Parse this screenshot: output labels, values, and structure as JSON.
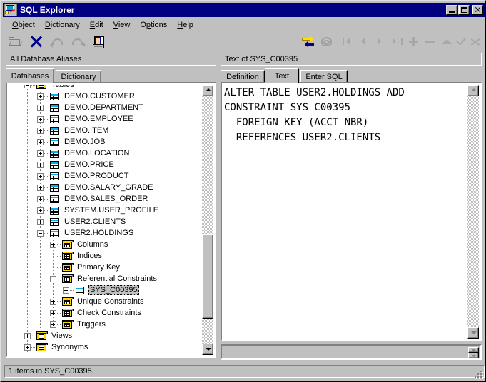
{
  "window": {
    "title": "SQL Explorer",
    "icon": "sql-explorer-icon",
    "minimize_label": "Minimize",
    "maximize_label": "Maximize",
    "close_label": "Close"
  },
  "menu": [
    {
      "label": "Object",
      "accel": "O"
    },
    {
      "label": "Dictionary",
      "accel": "D"
    },
    {
      "label": "Edit",
      "accel": "E"
    },
    {
      "label": "View",
      "accel": "V"
    },
    {
      "label": "Options",
      "accel": "O"
    },
    {
      "label": "Help",
      "accel": "H"
    }
  ],
  "toolbar": {
    "left": [
      {
        "name": "open-icon",
        "enabled": false
      },
      {
        "name": "delete-x-icon",
        "enabled": true
      },
      {
        "name": "undo-icon",
        "enabled": false
      },
      {
        "name": "redo-icon",
        "enabled": false
      },
      {
        "name": "report-icon",
        "enabled": true
      }
    ],
    "right": [
      {
        "name": "swap-arrows-icon",
        "enabled": true
      },
      {
        "name": "refresh-swirl-icon",
        "enabled": false
      },
      {
        "name": "first-record-icon",
        "enabled": false
      },
      {
        "name": "previous-record-icon",
        "enabled": false
      },
      {
        "name": "next-record-icon",
        "enabled": false
      },
      {
        "name": "last-record-icon",
        "enabled": false
      },
      {
        "name": "insert-record-icon",
        "enabled": false
      },
      {
        "name": "delete-record-icon",
        "enabled": false
      },
      {
        "name": "edit-record-icon",
        "enabled": false
      },
      {
        "name": "post-edit-icon",
        "enabled": false
      },
      {
        "name": "cancel-edit-icon",
        "enabled": false
      },
      {
        "name": "refresh-record-icon",
        "enabled": false
      }
    ]
  },
  "left_pane": {
    "caption": "All Database Aliases",
    "tabs": [
      {
        "label": "Databases",
        "active": true
      },
      {
        "label": "Dictionary",
        "active": false
      }
    ],
    "tree": [
      {
        "label": "Tables",
        "icon": "folder-icon",
        "depth": 1,
        "expander": "minus",
        "selected": false
      },
      {
        "label": "DEMO.CUSTOMER",
        "icon": "table-icon",
        "depth": 2,
        "expander": "plus",
        "selected": false
      },
      {
        "label": "DEMO.DEPARTMENT",
        "icon": "table-icon",
        "depth": 2,
        "expander": "plus",
        "selected": false
      },
      {
        "label": "DEMO.EMPLOYEE",
        "icon": "table-icon",
        "depth": 2,
        "expander": "plus",
        "selected": false
      },
      {
        "label": "DEMO.ITEM",
        "icon": "table-icon",
        "depth": 2,
        "expander": "plus",
        "selected": false
      },
      {
        "label": "DEMO.JOB",
        "icon": "table-icon",
        "depth": 2,
        "expander": "plus",
        "selected": false
      },
      {
        "label": "DEMO.LOCATION",
        "icon": "table-icon",
        "depth": 2,
        "expander": "plus",
        "selected": false
      },
      {
        "label": "DEMO.PRICE",
        "icon": "table-icon",
        "depth": 2,
        "expander": "plus",
        "selected": false
      },
      {
        "label": "DEMO.PRODUCT",
        "icon": "table-icon",
        "depth": 2,
        "expander": "plus",
        "selected": false
      },
      {
        "label": "DEMO.SALARY_GRADE",
        "icon": "table-icon",
        "depth": 2,
        "expander": "plus",
        "selected": false
      },
      {
        "label": "DEMO.SALES_ORDER",
        "icon": "table-icon",
        "depth": 2,
        "expander": "plus",
        "selected": false
      },
      {
        "label": "SYSTEM.USER_PROFILE",
        "icon": "table-icon",
        "depth": 2,
        "expander": "plus",
        "selected": false
      },
      {
        "label": "USER2.CLIENTS",
        "icon": "table-icon",
        "depth": 2,
        "expander": "plus",
        "selected": false
      },
      {
        "label": "USER2.HOLDINGS",
        "icon": "table-icon",
        "depth": 2,
        "expander": "minus",
        "selected": false
      },
      {
        "label": "Columns",
        "icon": "folder-icon",
        "depth": 3,
        "expander": "plus",
        "selected": false
      },
      {
        "label": "Indices",
        "icon": "folder-icon",
        "depth": 3,
        "expander": "none",
        "selected": false
      },
      {
        "label": "Primary Key",
        "icon": "folder-icon",
        "depth": 3,
        "expander": "none",
        "selected": false
      },
      {
        "label": "Referential Constraints",
        "icon": "folder-icon",
        "depth": 3,
        "expander": "minus",
        "selected": false
      },
      {
        "label": "SYS_C00395",
        "icon": "table-icon",
        "depth": 4,
        "expander": "plus",
        "selected": true
      },
      {
        "label": "Unique Constraints",
        "icon": "folder-icon",
        "depth": 3,
        "expander": "plus",
        "selected": false
      },
      {
        "label": "Check Constraints",
        "icon": "folder-icon",
        "depth": 3,
        "expander": "plus",
        "selected": false
      },
      {
        "label": "Triggers",
        "icon": "folder-icon",
        "depth": 3,
        "expander": "plus",
        "selected": false
      },
      {
        "label": "Views",
        "icon": "folder-icon",
        "depth": 1,
        "expander": "plus",
        "selected": false
      },
      {
        "label": "Synonyms",
        "icon": "folder-icon",
        "depth": 1,
        "expander": "plus",
        "selected": false
      }
    ]
  },
  "right_pane": {
    "caption": "Text of SYS_C00395",
    "tabs": [
      {
        "label": "Definition",
        "active": false
      },
      {
        "label": "Text",
        "active": true
      },
      {
        "label": "Enter SQL",
        "active": false
      }
    ],
    "sql_text": "ALTER TABLE USER2.HOLDINGS ADD\nCONSTRAINT SYS_C00395\n  FOREIGN KEY (ACCT_NBR)\n  REFERENCES USER2.CLIENTS",
    "bottom_field_value": ""
  },
  "statusbar": {
    "text": "1 items in SYS_C00395."
  },
  "colors": {
    "titlebar": "#000080",
    "face": "#c0c0c0",
    "selection": "#c0c0c0",
    "folder": "#ffd700",
    "table_header": "#00b0f0",
    "delete_x": "#000080"
  }
}
